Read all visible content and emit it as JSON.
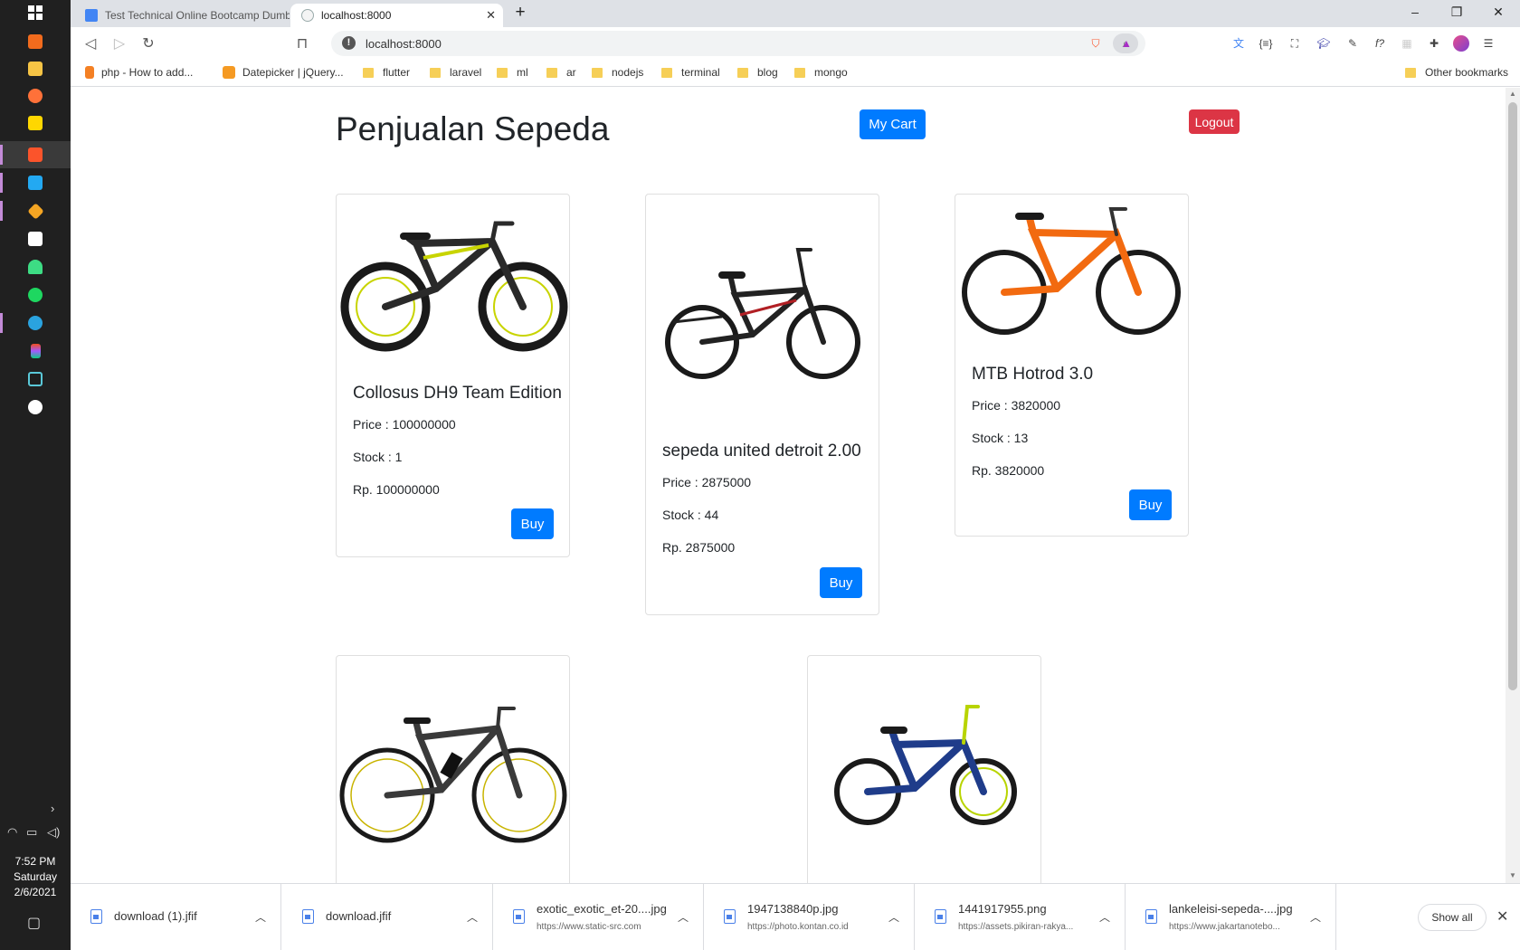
{
  "taskbar": {
    "time": "7:52 PM",
    "day": "Saturday",
    "date": "2/6/2021",
    "start_icon": "windows-icon"
  },
  "browser": {
    "tabs": [
      {
        "title": "Test Technical Online Bootcamp Dumb",
        "active": false
      },
      {
        "title": "localhost:8000",
        "active": true
      }
    ],
    "new_tab": "+",
    "url": "localhost:8000",
    "bookmarks": [
      {
        "label": "php - How to add...",
        "kind": "site"
      },
      {
        "label": "Datepicker | jQuery...",
        "kind": "site"
      },
      {
        "label": "flutter",
        "kind": "folder"
      },
      {
        "label": "laravel",
        "kind": "folder"
      },
      {
        "label": "ml",
        "kind": "folder"
      },
      {
        "label": "ar",
        "kind": "folder"
      },
      {
        "label": "nodejs",
        "kind": "folder"
      },
      {
        "label": "terminal",
        "kind": "folder"
      },
      {
        "label": "blog",
        "kind": "folder"
      },
      {
        "label": "mongo",
        "kind": "folder"
      }
    ],
    "other_bookmarks": "Other bookmarks"
  },
  "page": {
    "title": "Penjualan Sepeda",
    "cart_label": "My Cart",
    "logout_label": "Logout",
    "buy_label": "Buy",
    "products": [
      {
        "name": "Collosus DH9 Team Edition",
        "price": "Price : 100000000",
        "stock": "Stock : 1",
        "rp": "Rp. 100000000",
        "frame_color": "#c8d400"
      },
      {
        "name": "sepeda united detroit 2.00",
        "price": "Price : 2875000",
        "stock": "Stock : 44",
        "rp": "Rp. 2875000",
        "frame_color": "#222222"
      },
      {
        "name": "MTB Hotrod 3.0",
        "price": "Price : 3820000",
        "stock": "Stock : 13",
        "rp": "Rp. 3820000",
        "frame_color": "#f26a10"
      },
      {
        "name": "",
        "frame_color": "#3a3a3a"
      },
      {
        "name": "",
        "frame_color": "#1f3c8a"
      }
    ]
  },
  "downloads": [
    {
      "file": "download (1).jfif",
      "source": ""
    },
    {
      "file": "download.jfif",
      "source": ""
    },
    {
      "file": "exotic_exotic_et-20....jpg",
      "source": "https://www.static-src.com"
    },
    {
      "file": "1947138840p.jpg",
      "source": "https://photo.kontan.co.id"
    },
    {
      "file": "1441917955.png",
      "source": "https://assets.pikiran-rakya..."
    },
    {
      "file": "lankeleisi-sepeda-....jpg",
      "source": "https://www.jakartanotebo..."
    }
  ],
  "show_all": "Show all"
}
